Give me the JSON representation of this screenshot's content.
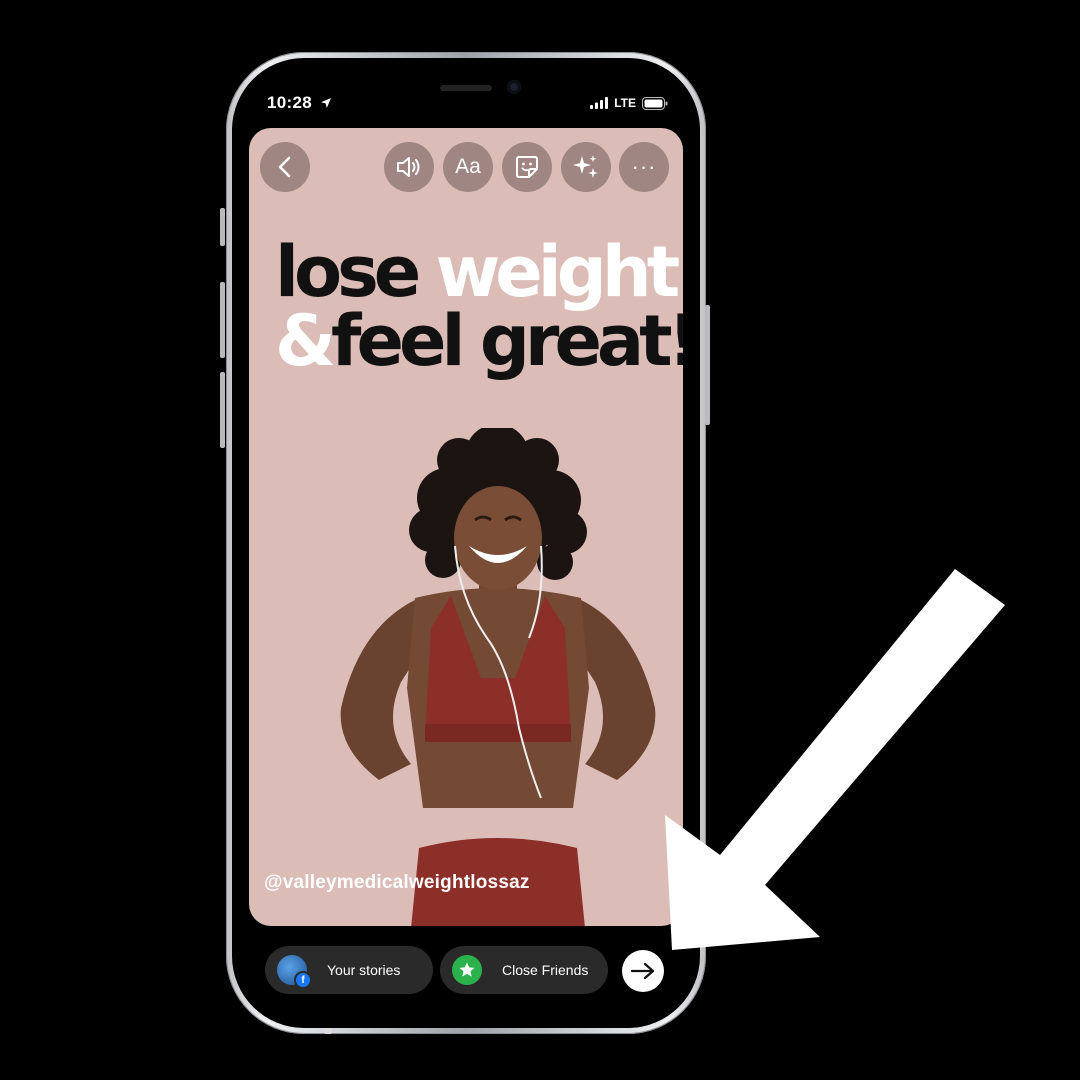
{
  "status_bar": {
    "time": "10:28",
    "network": "LTE"
  },
  "toolbar": {
    "back": "chevron-left-icon",
    "sound": "speaker-icon",
    "text_label": "Aa",
    "sticker": "sticker-icon",
    "effects": "sparkles-icon",
    "more_label": "···"
  },
  "story": {
    "headline": {
      "line1_dark": "lose ",
      "line1_light": "weight",
      "line2_light": "&",
      "line2_dark": "feel great!"
    },
    "handle": "@valleymedicalweightlossaz",
    "background_color": "#dbbcb7"
  },
  "share_bar": {
    "your_stories_label": "Your stories",
    "close_friends_label": "Close Friends",
    "send": "arrow-right-icon"
  },
  "colors": {
    "accent_green": "#2bb24c",
    "facebook_blue": "#1877f2",
    "pill_bg": "#2a2a2a"
  }
}
